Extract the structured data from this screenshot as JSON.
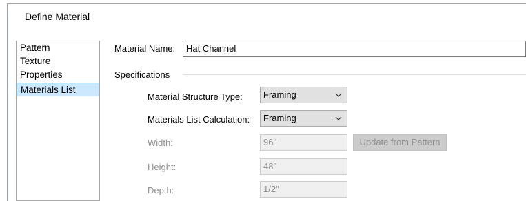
{
  "dialog": {
    "title": "Define Material"
  },
  "sidebar": {
    "items": [
      {
        "label": "Pattern",
        "selected": false
      },
      {
        "label": "Texture",
        "selected": false
      },
      {
        "label": "Properties",
        "selected": false
      },
      {
        "label": "Materials List",
        "selected": true
      }
    ]
  },
  "material_name": {
    "label": "Material Name:",
    "value": "Hat Channel"
  },
  "specifications": {
    "group_label": "Specifications",
    "structure_type": {
      "label": "Material Structure Type:",
      "value": "Framing"
    },
    "list_calculation": {
      "label": "Materials List Calculation:",
      "value": "Framing"
    },
    "width": {
      "label": "Width:",
      "value": "96\""
    },
    "update_button": "Update from Pattern",
    "height": {
      "label": "Height:",
      "value": "48\""
    },
    "depth": {
      "label": "Depth:",
      "value": "1/2\""
    }
  }
}
